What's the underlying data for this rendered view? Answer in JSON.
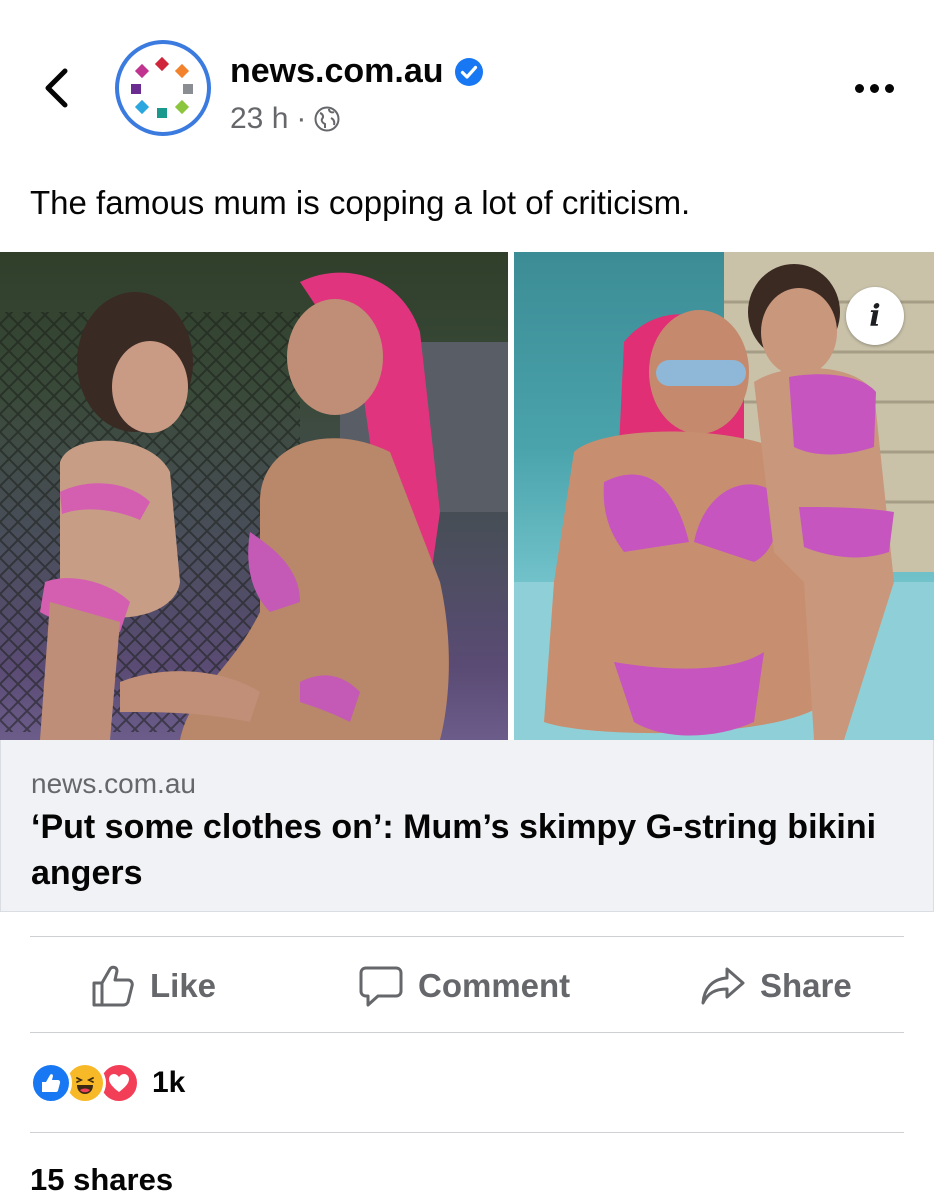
{
  "post": {
    "page_name": "news.com.au",
    "time": "23 h",
    "separator": "·",
    "caption": "The famous mum is copping a lot of criticism."
  },
  "link": {
    "domain": "news.com.au",
    "title": "‘Put some clothes on’: Mum’s skimpy G-string bikini angers"
  },
  "actions": {
    "like": "Like",
    "comment": "Comment",
    "share": "Share"
  },
  "reactions": {
    "icons": [
      "like-icon",
      "haha-icon",
      "love-icon"
    ],
    "count": "1k"
  },
  "shares": "15 shares",
  "colors": {
    "verified": "#1877f2",
    "avatar_ring": "#3b7be0",
    "muted_text": "#65676b",
    "link_card_bg": "#f0f2f5",
    "like": "#1877f2",
    "love": "#f33e58",
    "haha": "#f7b928"
  }
}
